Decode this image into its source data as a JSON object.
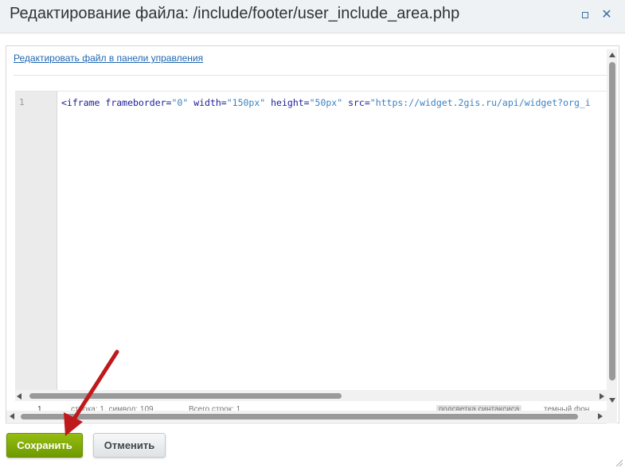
{
  "dialog": {
    "title": "Редактирование файла: /include/footer/user_include_area.php",
    "maximize_label": "□",
    "close_label": "✕"
  },
  "edit_link": "Редактировать файл в панели управления",
  "editor": {
    "line_numbers": [
      "1"
    ],
    "code": {
      "tag_open": "<iframe",
      "attr1": " frameborder=",
      "val1": "\"0\"",
      "attr2": " width=",
      "val2": "\"150px\"",
      "attr3": " height=",
      "val3": "\"50px\"",
      "attr4": " src=",
      "val4": "\"https://widget.2gis.ru/api/widget?org_i"
    }
  },
  "status_bar": {
    "line": "1",
    "info": "строка: 1, символ: 109",
    "total": "Всего строк: 1",
    "highlight_toggle": "подсветка синтаксиса",
    "theme": "темный фон"
  },
  "buttons": {
    "save": "Сохранить",
    "cancel": "Отменить"
  },
  "colors": {
    "save_button": "#86ad00",
    "annotation_arrow": "#c0191b",
    "link": "#2067b0"
  },
  "icons": [
    "maximize-icon",
    "close-icon",
    "annotation-arrow",
    "resize-grip-icon"
  ]
}
